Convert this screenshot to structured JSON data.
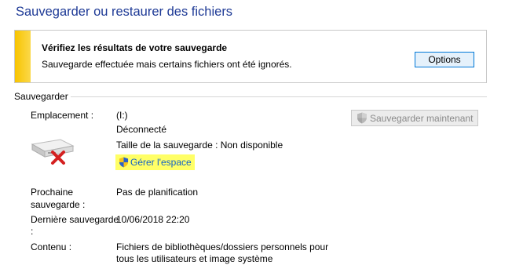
{
  "page": {
    "title": "Sauvegarder ou restaurer des fichiers"
  },
  "notice": {
    "heading": "Vérifiez les résultats de votre sauvegarde",
    "text": "Sauvegarde effectuée mais certains fichiers ont été ignorés.",
    "options_label": "Options",
    "accent_color": "#f7c400"
  },
  "section": {
    "label": "Sauvegarder",
    "backup_now_label": "Sauvegarder maintenant",
    "location_label": "Emplacement :",
    "location_value": "(I:)",
    "status": "Déconnecté",
    "size_text": "Taille de la sauvegarde : Non disponible",
    "manage_label": "Gérer l'espace",
    "next_label_line1": "Prochaine",
    "next_label_line2": "sauvegarde :",
    "next_value": "Pas de planification",
    "last_label_line1": "Dernière sauvegarde",
    "last_label_line2": ":",
    "last_value": "10/06/2018 22:20",
    "contents_label": "Contenu :",
    "contents_line1": "Fichiers de bibliothèques/dossiers personnels pour",
    "contents_line2": "tous les utilisateurs et image système",
    "icons": [
      "shield-icon",
      "drive-icon",
      "error-x-icon"
    ]
  }
}
